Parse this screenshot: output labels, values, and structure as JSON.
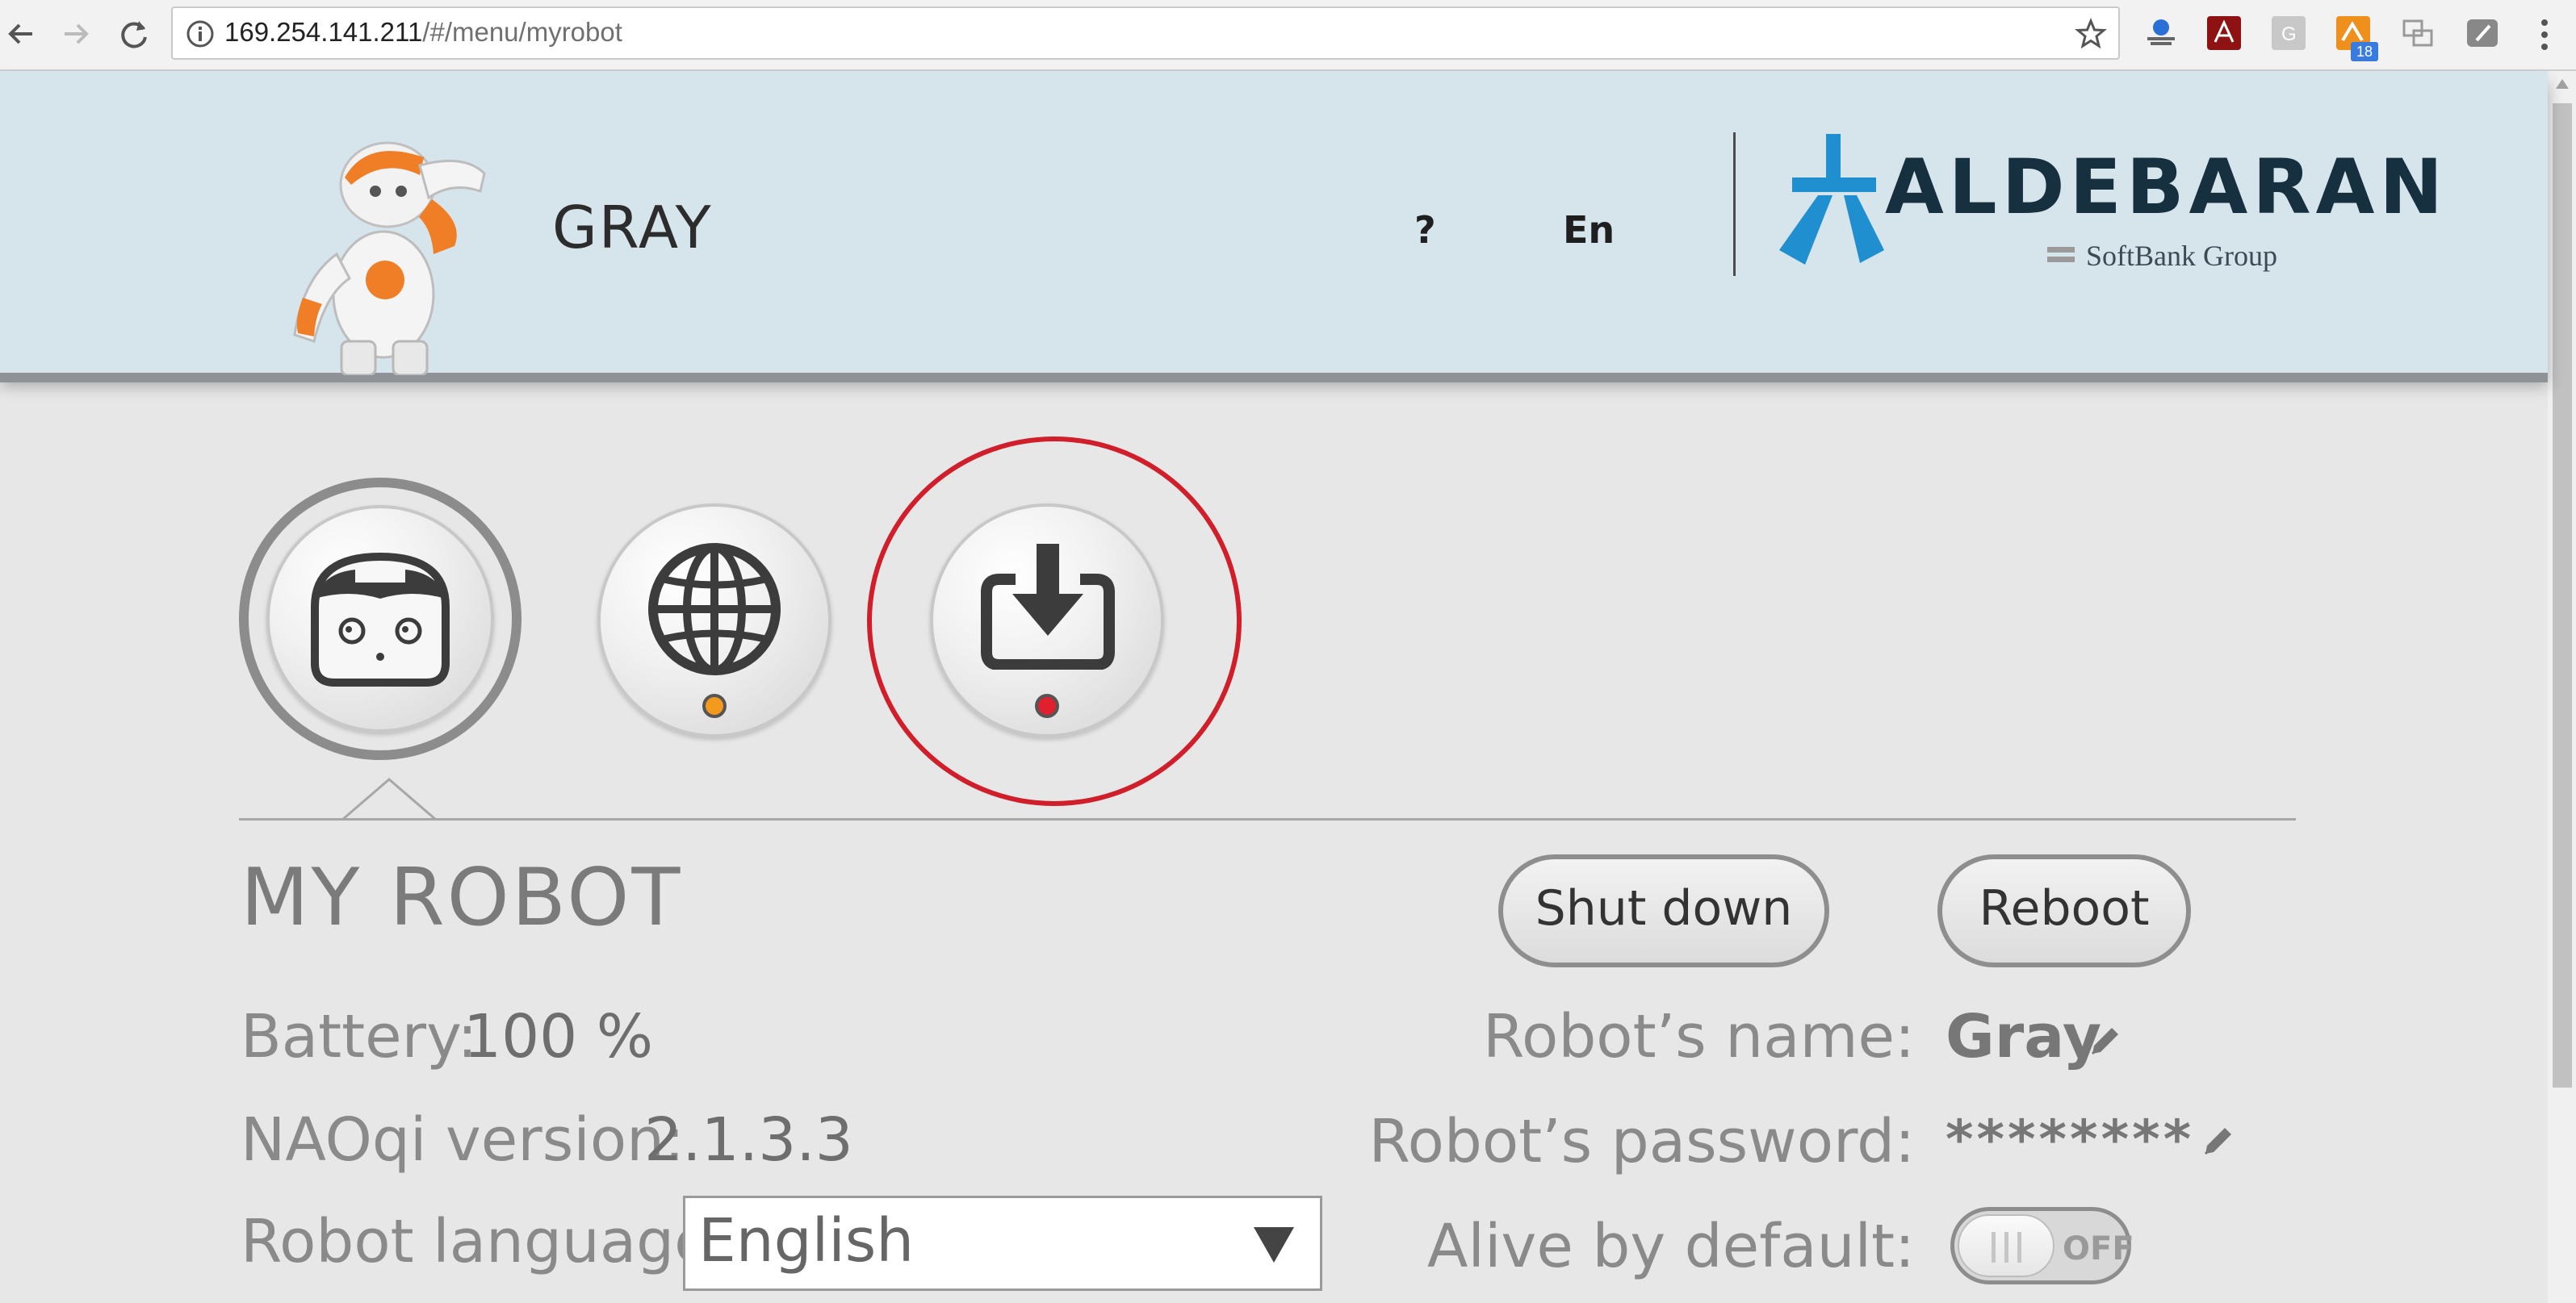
{
  "browser": {
    "url_host": "169.254.141.211",
    "url_path": "/#/menu/myrobot",
    "extension_badge": "18"
  },
  "header": {
    "robot_name": "GRAY",
    "help_label": "?",
    "language_label": "En",
    "brand_name": "ALDEBARAN",
    "brand_sub": "SoftBank Group"
  },
  "tabs": [
    {
      "name": "My Robot",
      "icon": "robot-face-icon",
      "selected": true
    },
    {
      "name": "Network",
      "icon": "globe-icon",
      "status_color": "#f39a1e"
    },
    {
      "name": "Software update",
      "icon": "download-icon",
      "status_color": "#e0202e"
    }
  ],
  "section": {
    "title": "MY ROBOT",
    "shutdown_label": "Shut down",
    "reboot_label": "Reboot"
  },
  "info": {
    "battery_label": "Battery:",
    "battery_value": "100 %",
    "naoqi_label": "NAOqi version:",
    "naoqi_value": "2.1.3.3",
    "language_label": "Robot language:",
    "language_value": "English",
    "name_label": "Robot’s name:",
    "name_value": "Gray",
    "password_label": "Robot’s password:",
    "password_value": "********",
    "alive_label": "Alive by default:",
    "alive_value": "OFF"
  },
  "colors": {
    "header_bg": "#d6e4ec",
    "brand_blue": "#1f8fcf",
    "highlight_red": "#d01e2a",
    "robot_orange": "#f07e26"
  }
}
